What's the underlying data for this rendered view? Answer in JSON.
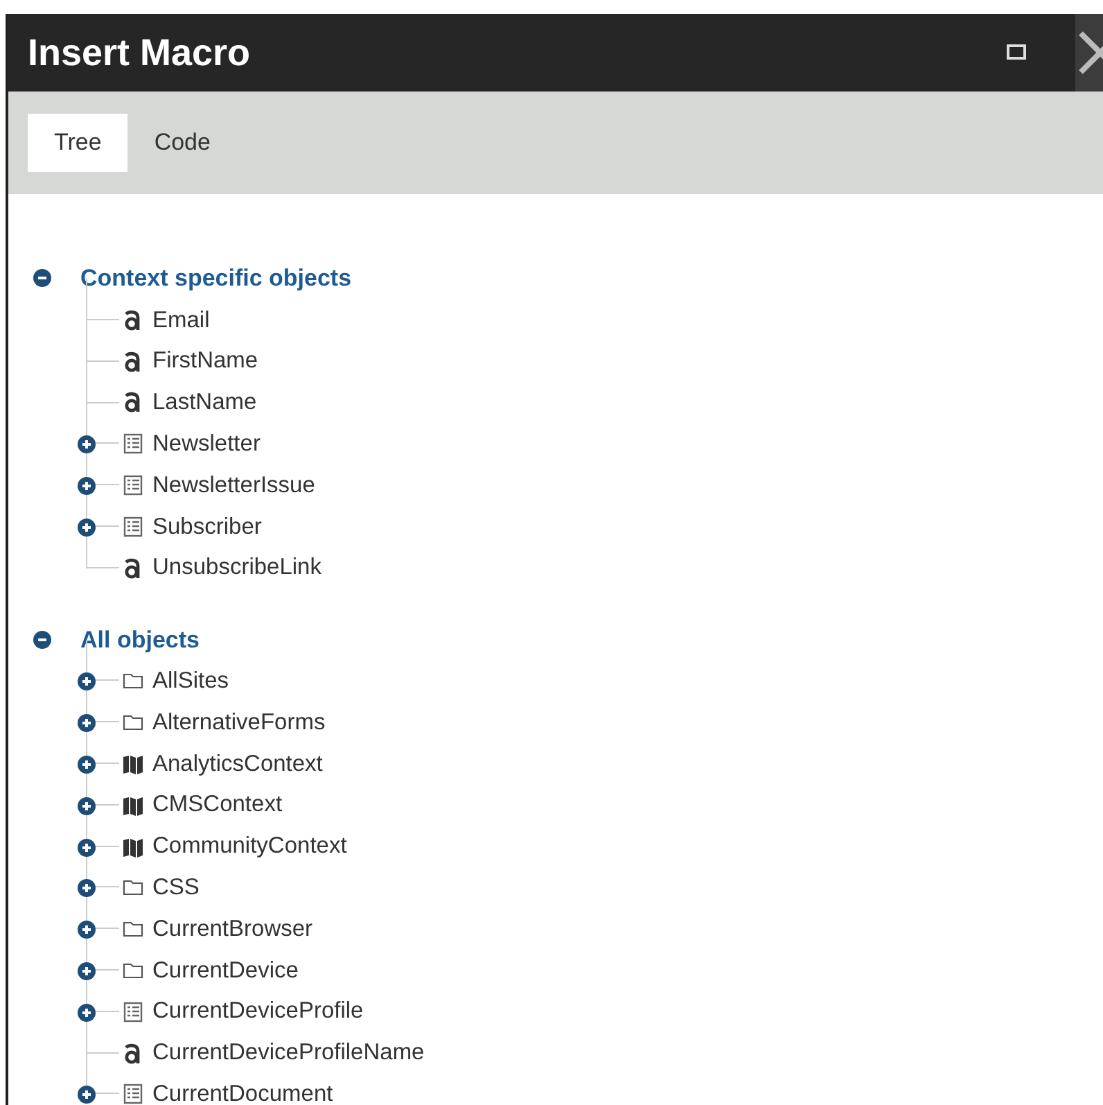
{
  "window": {
    "title": "Insert Macro"
  },
  "tabs": [
    {
      "label": "Tree",
      "selected": true
    },
    {
      "label": "Code",
      "selected": false
    }
  ],
  "tree": [
    {
      "label": "Context specific objects",
      "expanded": true,
      "children": [
        {
          "label": "Email",
          "kind": "property",
          "expandable": false
        },
        {
          "label": "FirstName",
          "kind": "property",
          "expandable": false
        },
        {
          "label": "LastName",
          "kind": "property",
          "expandable": false
        },
        {
          "label": "Newsletter",
          "kind": "object",
          "expandable": true
        },
        {
          "label": "NewsletterIssue",
          "kind": "object",
          "expandable": true
        },
        {
          "label": "Subscriber",
          "kind": "object",
          "expandable": true
        },
        {
          "label": "UnsubscribeLink",
          "kind": "property",
          "expandable": false
        }
      ]
    },
    {
      "label": "All objects",
      "expanded": true,
      "children": [
        {
          "label": "AllSites",
          "kind": "folder",
          "expandable": true
        },
        {
          "label": "AlternativeForms",
          "kind": "folder",
          "expandable": true
        },
        {
          "label": "AnalyticsContext",
          "kind": "map",
          "expandable": true
        },
        {
          "label": "CMSContext",
          "kind": "map",
          "expandable": true
        },
        {
          "label": "CommunityContext",
          "kind": "map",
          "expandable": true
        },
        {
          "label": "CSS",
          "kind": "folder",
          "expandable": true
        },
        {
          "label": "CurrentBrowser",
          "kind": "folder",
          "expandable": true
        },
        {
          "label": "CurrentDevice",
          "kind": "folder",
          "expandable": true
        },
        {
          "label": "CurrentDeviceProfile",
          "kind": "object",
          "expandable": true
        },
        {
          "label": "CurrentDeviceProfileName",
          "kind": "property",
          "expandable": false
        },
        {
          "label": "CurrentDocument",
          "kind": "object",
          "expandable": true
        }
      ]
    }
  ]
}
